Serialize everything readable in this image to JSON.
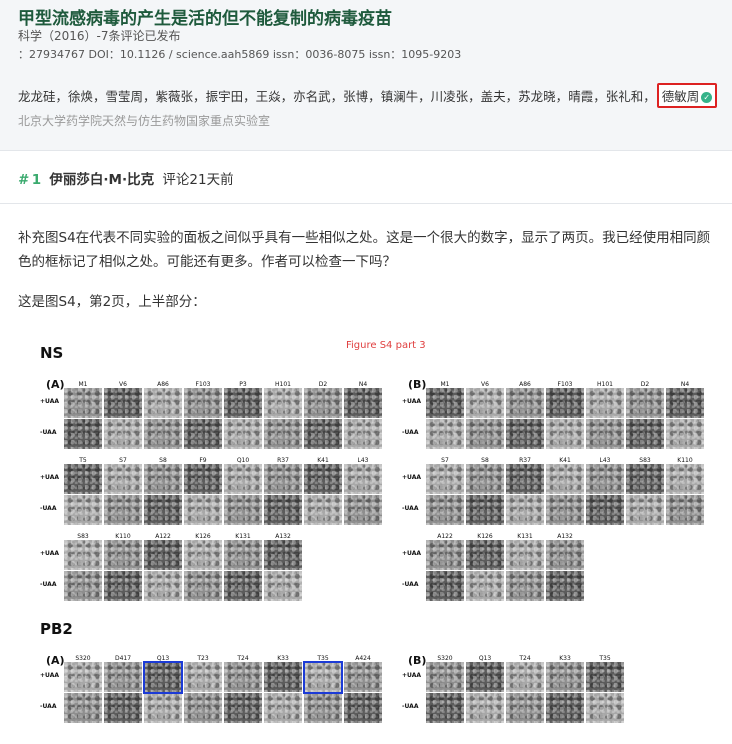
{
  "article": {
    "title": "甲型流感病毒的产生是活的但不能复制的病毒疫苗",
    "journal_line": "科学（2016）-7条评论已发布",
    "ids_line": "：27934767 DOI：10.1126 / science.aah5869 issn：0036-8075 issn：1095-9203",
    "authors": [
      "龙龙硅，",
      "徐焕，",
      "雪莹周，",
      "紫薇张，",
      "振宇田，",
      "王焱，",
      "亦名武，",
      "张博，",
      "镇澜牛，",
      "川凌张，",
      "盖夫，",
      "苏龙晓，",
      "晴霞，",
      "张礼和，"
    ],
    "last_author": "德敏周",
    "affiliation": "北京大学药学院天然与仿生药物国家重点实验室"
  },
  "comment": {
    "hash": "#",
    "number": "1",
    "author": "伊丽莎白·M·比克",
    "time": "评论21天前",
    "paragraph1": "补充图S4在代表不同实验的面板之间似乎具有一些相似之处。这是一个很大的数字，显示了两页。我已经使用相同颜色的框标记了相似之处。可能还有更多。作者可以检查一下吗？",
    "paragraph2": "这是图S4，第2页，上半部分："
  },
  "figure": {
    "title": "Figure S4 part 3",
    "sections": {
      "ns": "NS",
      "pb2": "PB2"
    },
    "row_labels": {
      "plus": "+UAA",
      "minus": "-UAA"
    },
    "ns_a": {
      "label": "(A)",
      "rows": [
        [
          "M1",
          "V6",
          "A86",
          "F103",
          "P3",
          "H101",
          "D2",
          "N4"
        ],
        [
          "T5",
          "S7",
          "S8",
          "F9",
          "Q10",
          "R37",
          "K41",
          "L43"
        ],
        [
          "S83",
          "K110",
          "A122",
          "K126",
          "K131",
          "A132"
        ]
      ]
    },
    "ns_b": {
      "label": "(B)",
      "rows": [
        [
          "M1",
          "V6",
          "A86",
          "F103",
          "H101",
          "D2",
          "N4"
        ],
        [
          "S7",
          "S8",
          "R37",
          "K41",
          "L43",
          "S83",
          "K110"
        ],
        [
          "A122",
          "K126",
          "K131",
          "A132"
        ]
      ]
    },
    "pb2_a": {
      "label": "(A)",
      "cols": [
        "S320",
        "D417",
        "Q13",
        "T23",
        "T24",
        "K33",
        "T35",
        "A424"
      ]
    },
    "pb2_b": {
      "label": "(B)",
      "cols": [
        "S320",
        "Q13",
        "T24",
        "K33",
        "T35"
      ]
    },
    "highlight_color": "#1c3bd6",
    "highlighted_tiles": [
      "Q13 +UAA",
      "T35 +UAA"
    ]
  }
}
